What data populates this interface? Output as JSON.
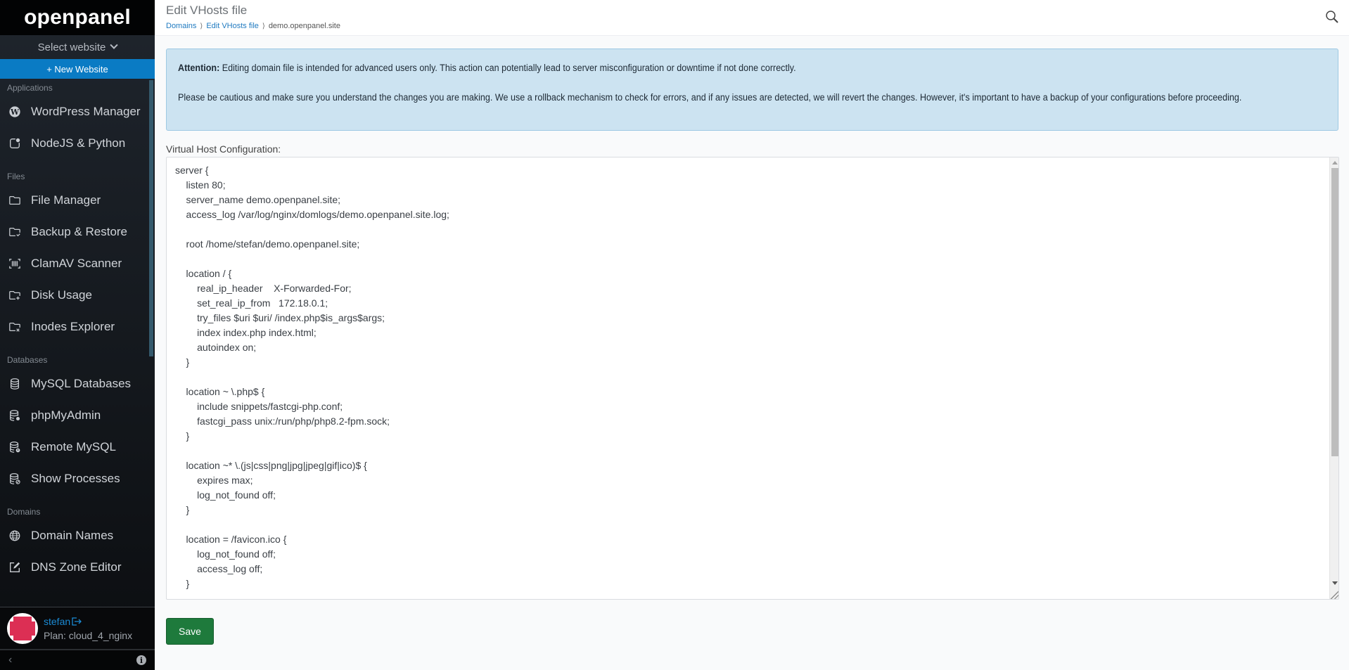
{
  "sidebar": {
    "brand": "openpanel",
    "site_select": "Select website",
    "new_website": "+ New Website",
    "sections": [
      {
        "label": "Applications",
        "items": [
          {
            "label": "WordPress Manager",
            "icon": "wordpress-icon"
          },
          {
            "label": "NodeJS & Python",
            "icon": "nodejs-icon"
          }
        ]
      },
      {
        "label": "Files",
        "items": [
          {
            "label": "File Manager",
            "icon": "folder-icon"
          },
          {
            "label": "Backup & Restore",
            "icon": "folder-check-icon"
          },
          {
            "label": "ClamAV Scanner",
            "icon": "barcode-scan-icon"
          },
          {
            "label": "Disk Usage",
            "icon": "folder-plus-icon"
          },
          {
            "label": "Inodes Explorer",
            "icon": "folder-x-icon"
          }
        ]
      },
      {
        "label": "Databases",
        "items": [
          {
            "label": "MySQL Databases",
            "icon": "database-icon"
          },
          {
            "label": "phpMyAdmin",
            "icon": "database-dot-icon"
          },
          {
            "label": "Remote MySQL",
            "icon": "database-info-icon"
          },
          {
            "label": "Show Processes",
            "icon": "database-block-icon"
          }
        ]
      },
      {
        "label": "Domains",
        "items": [
          {
            "label": "Domain Names",
            "icon": "globe-icon"
          },
          {
            "label": "DNS Zone Editor",
            "icon": "edit-icon"
          }
        ]
      }
    ],
    "user": {
      "name": "stefan",
      "plan": "Plan: cloud_4_nginx"
    }
  },
  "header": {
    "title": "Edit VHosts file",
    "breadcrumb": [
      "Domains",
      "Edit VHosts file",
      "demo.openpanel.site"
    ]
  },
  "alert": {
    "strong": "Attention:",
    "line1": " Editing domain file is intended for advanced users only. This action can potentially lead to server misconfiguration or downtime if not done correctly.",
    "line2": "Please be cautious and make sure you understand the changes you are making. We use a rollback mechanism to check for errors, and if any issues are detected, we will revert the changes. However, it's important to have a backup of your configurations before proceeding."
  },
  "editor": {
    "label": "Virtual Host Configuration:",
    "lines": [
      "server {",
      "    listen 80;",
      "    server_name demo.openpanel.site;",
      "    access_log /var/log/nginx/domlogs/demo.openpanel.site.log;",
      "",
      "    root /home/stefan/demo.openpanel.site;",
      "",
      "    location / {",
      "        real_ip_header    X-Forwarded-For;",
      "        set_real_ip_from   172.18.0.1;",
      "        try_files $uri $uri/ /index.php$is_args$args;",
      "        index index.php index.html;",
      "        autoindex on;",
      "    }",
      "",
      "    location ~ \\.php$ {",
      "        include snippets/fastcgi-php.conf;",
      "        fastcgi_pass unix:/run/php/php8.2-fpm.sock;",
      "    }",
      "",
      "    location ~* \\.(js|css|png|jpg|jpeg|gif|ico)$ {",
      "        expires max;",
      "        log_not_found off;",
      "    }",
      "",
      "    location = /favicon.ico {",
      "        log_not_found off;",
      "        access_log off;",
      "    }"
    ]
  },
  "actions": {
    "save": "Save"
  },
  "colors": {
    "primary": "#0a7bc4",
    "save": "#1e7a3c",
    "alert_bg": "#cce3f1",
    "avatar": "#dc2f54"
  }
}
